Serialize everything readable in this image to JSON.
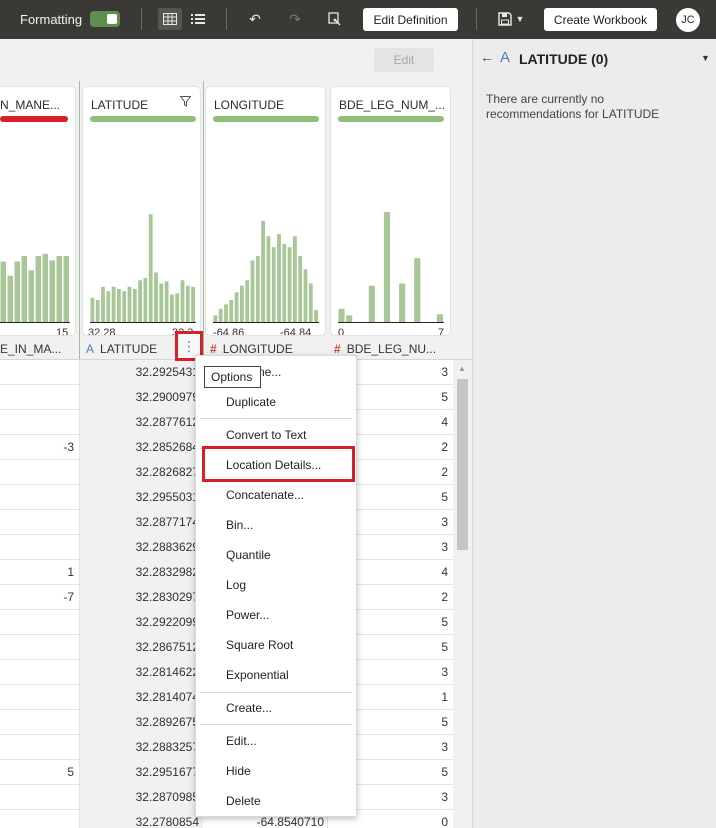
{
  "topbar": {
    "formatting_label": "Formatting",
    "edit_definition_label": "Edit Definition",
    "create_workbook_label": "Create Workbook",
    "avatar_initials": "JC"
  },
  "edit_button_label": "Edit",
  "columns": [
    {
      "name": "N_MANE...",
      "header": "E_IN_MA...",
      "type_icon": "",
      "quality_color": "#d6202a",
      "axis_min": "",
      "axis_max": "15",
      "bins": [
        0.55,
        0.42,
        0.55,
        0.6,
        0.47,
        0.6,
        0.62,
        0.56,
        0.6,
        0.6
      ]
    },
    {
      "name": "LATITUDE",
      "header": "LATITUDE",
      "type_icon": "A",
      "quality_color": "#8fbf7a",
      "axis_min": "32.28",
      "axis_max": "32.3",
      "bins": [
        0.22,
        0.2,
        0.32,
        0.28,
        0.32,
        0.3,
        0.28,
        0.32,
        0.3,
        0.38,
        0.4,
        0.98,
        0.45,
        0.35,
        0.37,
        0.25,
        0.26,
        0.38,
        0.33,
        0.32
      ]
    },
    {
      "name": "LONGITUDE",
      "header": "LONGITUDE",
      "type_icon": "#",
      "quality_color": "#8fbf7a",
      "axis_min": "-64.86",
      "axis_max": "-64.84",
      "bins": [
        0.06,
        0.12,
        0.16,
        0.2,
        0.27,
        0.33,
        0.38,
        0.56,
        0.6,
        0.92,
        0.78,
        0.68,
        0.8,
        0.71,
        0.68,
        0.78,
        0.6,
        0.48,
        0.35,
        0.11
      ]
    },
    {
      "name": "BDE_LEG_NUM_...",
      "header": "BDE_LEG_NU...",
      "type_icon": "#",
      "quality_color": "#8fbf7a",
      "axis_min": "0",
      "axis_max": "7",
      "bins": [
        0.12,
        0.06,
        0.0,
        0.0,
        0.33,
        0.0,
        1.0,
        0.0,
        0.35,
        0.0,
        0.58,
        0.0,
        0.0,
        0.07
      ]
    }
  ],
  "rows": [
    [
      "",
      "32.2925431",
      "",
      "3"
    ],
    [
      "",
      "32.2900979",
      "",
      "5"
    ],
    [
      "",
      "32.2877612",
      "",
      "4"
    ],
    [
      "-3",
      "32.2852684",
      "",
      "2"
    ],
    [
      "",
      "32.2826827",
      "",
      "2"
    ],
    [
      "",
      "32.2955031",
      "",
      "5"
    ],
    [
      "",
      "32.2877174",
      "",
      "3"
    ],
    [
      "",
      "32.2883629",
      "",
      "3"
    ],
    [
      "1",
      "32.2832982",
      "",
      "4"
    ],
    [
      "-7",
      "32.2830297",
      "",
      "2"
    ],
    [
      "",
      "32.2922099",
      "",
      "5"
    ],
    [
      "",
      "32.2867512",
      "",
      "5"
    ],
    [
      "",
      "32.2814622",
      "",
      "3"
    ],
    [
      "",
      "32.2814074",
      "",
      "1"
    ],
    [
      "",
      "32.2892675",
      "",
      "5"
    ],
    [
      "",
      "32.2883257",
      "",
      "3"
    ],
    [
      "5",
      "32.2951677",
      "",
      "5"
    ],
    [
      "",
      "32.2870985",
      "",
      "3"
    ],
    [
      "",
      "32.2780854",
      "-64.8540710",
      "0"
    ]
  ],
  "menu": {
    "tooltip": "Options",
    "partial_first_item": "ne...",
    "items": [
      {
        "label": "Duplicate"
      },
      {
        "label": "Convert to Text"
      },
      {
        "label": "Location Details..."
      },
      {
        "label": "Concatenate..."
      },
      {
        "label": "Bin..."
      },
      {
        "label": "Quantile"
      },
      {
        "label": "Log"
      },
      {
        "label": "Power..."
      },
      {
        "label": "Square Root"
      },
      {
        "label": "Exponential"
      },
      {
        "label": "Create..."
      },
      {
        "label": "Edit..."
      },
      {
        "label": "Hide"
      },
      {
        "label": "Delete"
      }
    ]
  },
  "right_panel": {
    "type_icon": "A",
    "title": "LATITUDE (0)",
    "message": "There are currently no recommendations for LATITUDE"
  },
  "colors": {
    "histogram_bar": "#a7c896",
    "highlight": "#d6202a",
    "topbar": "#3a3936"
  }
}
